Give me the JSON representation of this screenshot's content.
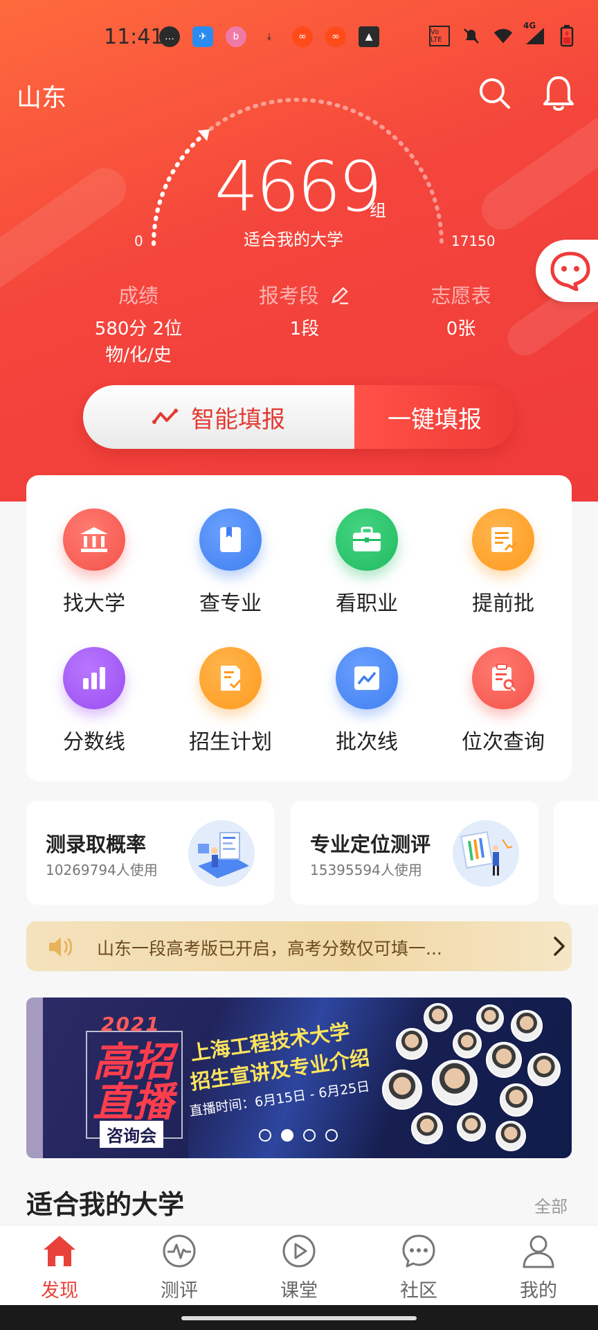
{
  "status_bar": {
    "time": "11:41",
    "network": "4G",
    "volte": "Vo LTE"
  },
  "header": {
    "province": "山东",
    "search_icon": "search-icon",
    "bell_icon": "bell-icon"
  },
  "gauge": {
    "value": "4669",
    "unit": "组",
    "subtitle": "适合我的大学",
    "min": "0",
    "max": "17150",
    "fill_fraction": 0.27
  },
  "stats": [
    {
      "title": "成绩",
      "line1": "580分 2位",
      "line2": "物/化/史"
    },
    {
      "title": "报考段",
      "line1": "1段",
      "line2": ""
    },
    {
      "title": "志愿表",
      "line1": "0张",
      "line2": ""
    }
  ],
  "cta": {
    "smart_label": "智能填报",
    "oneclick_label": "一键填报"
  },
  "features": [
    {
      "label": "找大学",
      "icon": "university-icon",
      "color": "#f4534b"
    },
    {
      "label": "查专业",
      "icon": "book-icon",
      "color": "#3f7ff0"
    },
    {
      "label": "看职业",
      "icon": "briefcase-icon",
      "color": "#21bb62"
    },
    {
      "label": "提前批",
      "icon": "document-chart-icon",
      "color": "#ff9a1f"
    },
    {
      "label": "分数线",
      "icon": "bar-chart-icon",
      "color": "#9a4ef0"
    },
    {
      "label": "招生计划",
      "icon": "plan-document-icon",
      "color": "#ff9a1f"
    },
    {
      "label": "批次线",
      "icon": "line-chart-icon",
      "color": "#3f7ff0"
    },
    {
      "label": "位次查询",
      "icon": "clipboard-search-icon",
      "color": "#f4534b"
    }
  ],
  "tools": [
    {
      "title": "测录取概率",
      "users": "10269794人使用"
    },
    {
      "title": "专业定位测评",
      "users": "15395594人使用"
    }
  ],
  "notice": {
    "text": "山东一段高考版已开启，高考分数仅可填一..."
  },
  "banner": {
    "year": "2021",
    "big1": "高招",
    "big2": "直播",
    "tag": "咨询会",
    "line1": "上海工程技术大学",
    "line2": "招生宣讲及专业介绍",
    "time": "直播时间：6月15日 - 6月25日",
    "active_dot": 1,
    "dot_count": 4
  },
  "section": {
    "title": "适合我的大学",
    "more": "全部"
  },
  "bottom_nav": [
    {
      "label": "发现",
      "icon": "home-icon",
      "active": true
    },
    {
      "label": "测评",
      "icon": "pulse-icon",
      "active": false
    },
    {
      "label": "课堂",
      "icon": "play-icon",
      "active": false
    },
    {
      "label": "社区",
      "icon": "chat-icon",
      "active": false
    },
    {
      "label": "我的",
      "icon": "user-icon",
      "active": false
    }
  ],
  "colors": {
    "primary_red": "#ef3b3a",
    "accent_red": "#e8413a",
    "notice_text": "#6b4a1e"
  }
}
